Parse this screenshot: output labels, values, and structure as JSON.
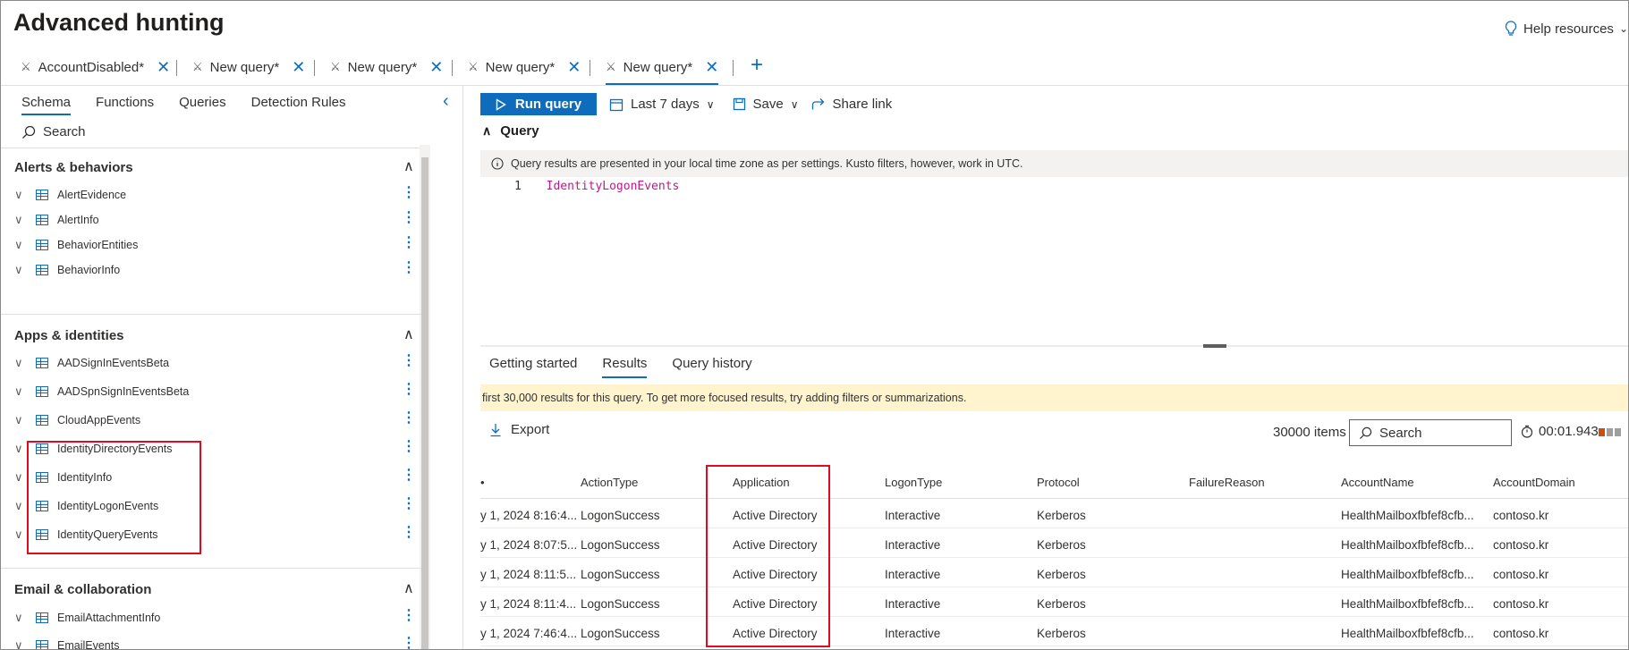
{
  "page": {
    "title": "Advanced hunting",
    "help": "Help resources"
  },
  "query_tabs": [
    {
      "label": "AccountDisabled*"
    },
    {
      "label": "New query*"
    },
    {
      "label": "New query*"
    },
    {
      "label": "New query*"
    },
    {
      "label": "New query*"
    }
  ],
  "left": {
    "tabs": [
      "Schema",
      "Functions",
      "Queries",
      "Detection Rules"
    ],
    "search_label": "Search",
    "sections": [
      {
        "title": "Alerts & behaviors",
        "items": [
          "AlertEvidence",
          "AlertInfo",
          "BehaviorEntities",
          "BehaviorInfo"
        ]
      },
      {
        "title": "Apps & identities",
        "items": [
          "AADSignInEventsBeta",
          "AADSpnSignInEventsBeta",
          "CloudAppEvents",
          "IdentityDirectoryEvents",
          "IdentityInfo",
          "IdentityLogonEvents",
          "IdentityQueryEvents"
        ]
      },
      {
        "title": "Email & collaboration",
        "items": [
          "EmailAttachmentInfo",
          "EmailEvents"
        ]
      }
    ]
  },
  "toolbar": {
    "run": "Run query",
    "range": "Last 7 days",
    "save": "Save",
    "share": "Share link"
  },
  "query": {
    "header": "Query",
    "info": "Query results are presented in your local time zone as per settings. Kusto filters, however, work in UTC.",
    "line_number": "1",
    "code": "IdentityLogonEvents"
  },
  "results": {
    "tabs": [
      "Getting started",
      "Results",
      "Query history"
    ],
    "warning": "first 30,000 results for this query. To get more focused results, try adding filters or summarizations.",
    "export": "Export",
    "count": "30000 items",
    "search_placeholder": "Search",
    "elapsed": "00:01.943",
    "columns": [
      "ActionType",
      "Application",
      "LogonType",
      "Protocol",
      "FailureReason",
      "AccountName",
      "AccountDomain"
    ],
    "rows": [
      {
        "ts": "y 1, 2024 8:16:4...",
        "action": "LogonSuccess",
        "app": "Active Directory",
        "logon": "Interactive",
        "proto": "Kerberos",
        "fail": "",
        "acct": "HealthMailboxfbfef8cfb...",
        "domain": "contoso.kr"
      },
      {
        "ts": "y 1, 2024 8:07:5...",
        "action": "LogonSuccess",
        "app": "Active Directory",
        "logon": "Interactive",
        "proto": "Kerberos",
        "fail": "",
        "acct": "HealthMailboxfbfef8cfb...",
        "domain": "contoso.kr"
      },
      {
        "ts": "y 1, 2024 8:11:5...",
        "action": "LogonSuccess",
        "app": "Active Directory",
        "logon": "Interactive",
        "proto": "Kerberos",
        "fail": "",
        "acct": "HealthMailboxfbfef8cfb...",
        "domain": "contoso.kr"
      },
      {
        "ts": "y 1, 2024 8:11:4...",
        "action": "LogonSuccess",
        "app": "Active Directory",
        "logon": "Interactive",
        "proto": "Kerberos",
        "fail": "",
        "acct": "HealthMailboxfbfef8cfb...",
        "domain": "contoso.kr"
      },
      {
        "ts": "y 1, 2024 7:46:4...",
        "action": "LogonSuccess",
        "app": "Active Directory",
        "logon": "Interactive",
        "proto": "Kerberos",
        "fail": "",
        "acct": "HealthMailboxfbfef8cfb...",
        "domain": "contoso.kr"
      }
    ]
  },
  "colors": {
    "accent": "#0f6cbd",
    "highlight": "#e00b1c",
    "warning_bg": "#fff4ce"
  }
}
